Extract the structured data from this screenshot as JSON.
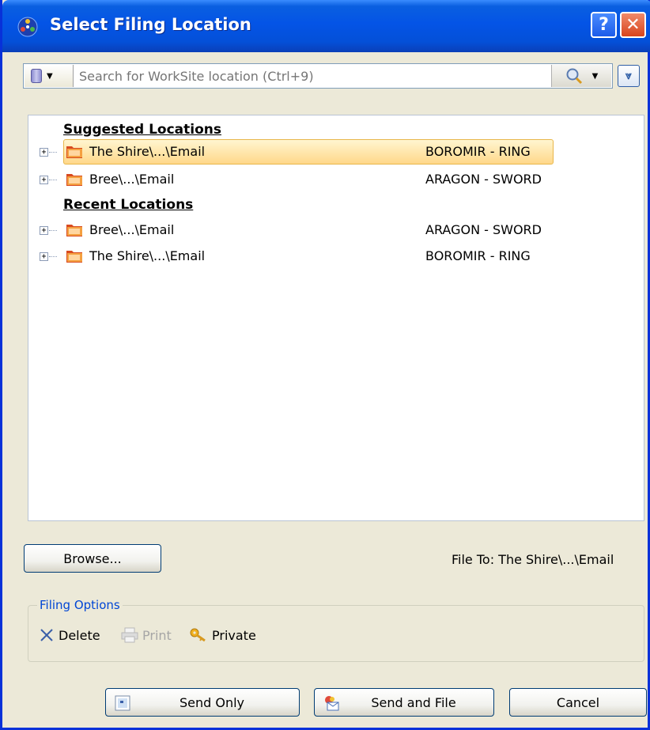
{
  "window": {
    "title": "Select Filing Location",
    "help_label": "?",
    "close_label": "✕"
  },
  "search": {
    "placeholder": "Search for WorkSite location (Ctrl+9)",
    "value": ""
  },
  "suggested": {
    "header": "Suggested Locations",
    "items": [
      {
        "name": "The Shire\\...\\Email",
        "owner": "BOROMIR - RING",
        "selected": true
      },
      {
        "name": "Bree\\...\\Email",
        "owner": "ARAGON - SWORD",
        "selected": false
      }
    ]
  },
  "recent": {
    "header": "Recent Locations",
    "items": [
      {
        "name": "Bree\\...\\Email",
        "owner": "ARAGON - SWORD"
      },
      {
        "name": "The Shire\\...\\Email",
        "owner": "BOROMIR - RING"
      }
    ]
  },
  "browse_label": "Browse...",
  "file_to": "File To: The Shire\\...\\Email",
  "filing_options": {
    "legend": "Filing Options",
    "delete": "Delete",
    "print": "Print",
    "private": "Private"
  },
  "buttons": {
    "send_only": "Send Only",
    "send_and_file": "Send and File",
    "cancel": "Cancel"
  },
  "colors": {
    "titlebar": "#0454e6",
    "selection": "#ffd88a",
    "legend_text": "#0046d5"
  }
}
